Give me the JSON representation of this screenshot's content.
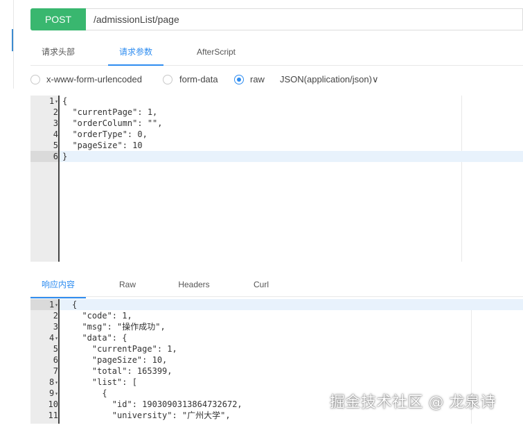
{
  "request": {
    "method": "POST",
    "url": "/admissionList/page"
  },
  "request_tabs": [
    {
      "label": "请求头部",
      "active": false
    },
    {
      "label": "请求参数",
      "active": true
    },
    {
      "label": "AfterScript",
      "active": false
    }
  ],
  "body_types": {
    "options": [
      "x-www-form-urlencoded",
      "form-data",
      "raw"
    ],
    "selected": "raw",
    "content_type": "JSON(application/json)∨"
  },
  "request_editor": {
    "lines": [
      "1",
      "2",
      "3",
      "4",
      "5",
      "6"
    ],
    "code": [
      "{",
      "  \"currentPage\": 1,",
      "  \"orderColumn\": \"\",",
      "  \"orderType\": 0,",
      "  \"pageSize\": 10",
      "}"
    ]
  },
  "response_tabs": [
    {
      "label": "响应内容",
      "active": true
    },
    {
      "label": "Raw",
      "active": false
    },
    {
      "label": "Headers",
      "active": false
    },
    {
      "label": "Curl",
      "active": false
    }
  ],
  "response_editor": {
    "lines": [
      "1",
      "2",
      "3",
      "4",
      "5",
      "6",
      "7",
      "8",
      "9",
      "10",
      "11"
    ],
    "code": [
      "{",
      "  \"code\": 1,",
      "  \"msg\": \"操作成功\",",
      "  \"data\": {",
      "    \"currentPage\": 1,",
      "    \"pageSize\": 10,",
      "    \"total\": 165399,",
      "    \"list\": [",
      "      {",
      "        \"id\": 1903090313864732672,",
      "        \"university\": \"广州大学\","
    ]
  },
  "watermark": "掘金技术社区 @ 龙泉诗",
  "colors": {
    "method_bg": "#39b76f",
    "accent": "#2d8cf0"
  }
}
